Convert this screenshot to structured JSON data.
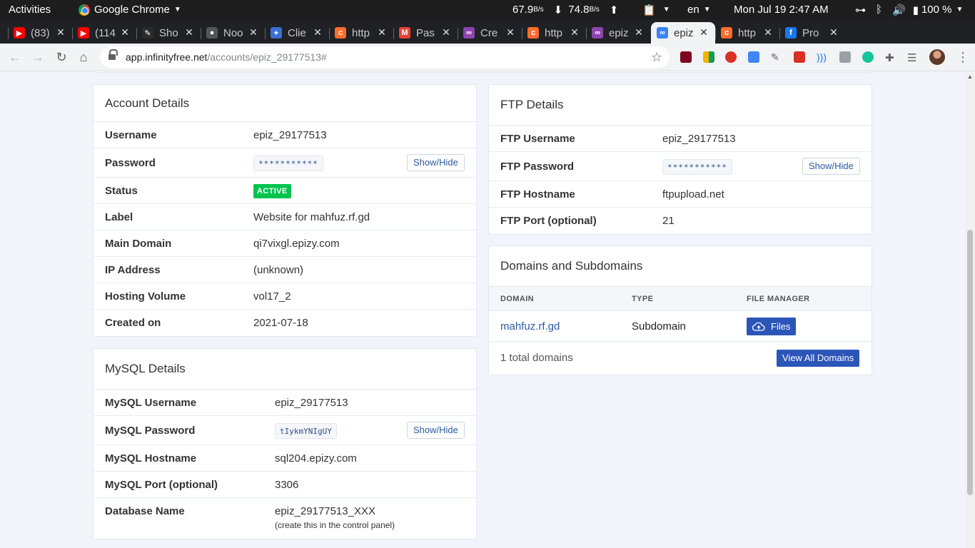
{
  "topbar": {
    "activities": "Activities",
    "app_name": "Google Chrome",
    "net_down": "67.9",
    "net_down_unit": "B/s",
    "net_up": "74.8",
    "net_up_unit": "B/s",
    "lang": "en",
    "datetime": "Mon Jul 19  2:47 AM",
    "battery": "100 %"
  },
  "tabs": [
    {
      "title": "(83)",
      "fav_color": "#ff0000",
      "fav_glyph": "▶"
    },
    {
      "title": "(114",
      "fav_color": "#ff0000",
      "fav_glyph": "▶"
    },
    {
      "title": "Sho",
      "fav_color": "#2b2b2b",
      "fav_glyph": "✎"
    },
    {
      "title": "Noo",
      "fav_color": "#555555",
      "fav_glyph": "●"
    },
    {
      "title": "Clie",
      "fav_color": "#3c6fd6",
      "fav_glyph": "✦"
    },
    {
      "title": "http",
      "fav_color": "#ff6c2c",
      "fav_glyph": "c"
    },
    {
      "title": "Pas",
      "fav_color": "#ea4335",
      "fav_glyph": "M"
    },
    {
      "title": "Cre",
      "fav_color": "#8e44ad",
      "fav_glyph": "∞"
    },
    {
      "title": "http",
      "fav_color": "#ff6c2c",
      "fav_glyph": "c"
    },
    {
      "title": "epiz",
      "fav_color": "#8e44ad",
      "fav_glyph": "∞"
    },
    {
      "title": "epiz",
      "fav_color": "#3b82f6",
      "fav_glyph": "∞"
    },
    {
      "title": "http",
      "fav_color": "#ff6c2c",
      "fav_glyph": "c"
    },
    {
      "title": "Pro",
      "fav_color": "#1877f2",
      "fav_glyph": "f"
    }
  ],
  "omnibox": {
    "host": "app.infinityfree.net",
    "path": "/accounts/epiz_29177513#"
  },
  "account": {
    "title": "Account Details",
    "rows": [
      {
        "key": "Username",
        "value": "epiz_29177513"
      },
      {
        "key": "Password",
        "value": "***********"
      },
      {
        "key": "Status",
        "value": "ACTIVE"
      },
      {
        "key": "Label",
        "value": "Website for mahfuz.rf.gd"
      },
      {
        "key": "Main Domain",
        "value": "qi7vixgl.epizy.com"
      },
      {
        "key": "IP Address",
        "value": "(unknown)"
      },
      {
        "key": "Hosting Volume",
        "value": "vol17_2"
      },
      {
        "key": "Created on",
        "value": "2021-07-18"
      }
    ],
    "show_hide": "Show/Hide"
  },
  "mysql": {
    "title": "MySQL Details",
    "rows": [
      {
        "key": "MySQL Username",
        "value": "epiz_29177513"
      },
      {
        "key": "MySQL Password",
        "value": "tIykmYNIgUY"
      },
      {
        "key": "MySQL Hostname",
        "value": "sql204.epizy.com"
      },
      {
        "key": "MySQL Port (optional)",
        "value": "3306"
      },
      {
        "key": "Database Name",
        "value": "epiz_29177513_XXX",
        "note": "(create this in the control panel)"
      }
    ],
    "show_hide": "Show/Hide"
  },
  "ftp": {
    "title": "FTP Details",
    "rows": [
      {
        "key": "FTP Username",
        "value": "epiz_29177513"
      },
      {
        "key": "FTP Password",
        "value": "***********"
      },
      {
        "key": "FTP Hostname",
        "value": "ftpupload.net"
      },
      {
        "key": "FTP Port (optional)",
        "value": "21"
      }
    ],
    "show_hide": "Show/Hide"
  },
  "domains": {
    "title": "Domains and Subdomains",
    "headers": [
      "DOMAIN",
      "TYPE",
      "FILE MANAGER"
    ],
    "rows": [
      {
        "domain": "mahfuz.rf.gd",
        "type": "Subdomain",
        "action": "Files"
      }
    ],
    "total": "1 total domains",
    "view_all": "View All Domains"
  },
  "colors": {
    "accent": "#2c55b8",
    "link": "#2c5aa0",
    "active_badge": "#00c44f",
    "page_bg": "#f1f5fb"
  }
}
